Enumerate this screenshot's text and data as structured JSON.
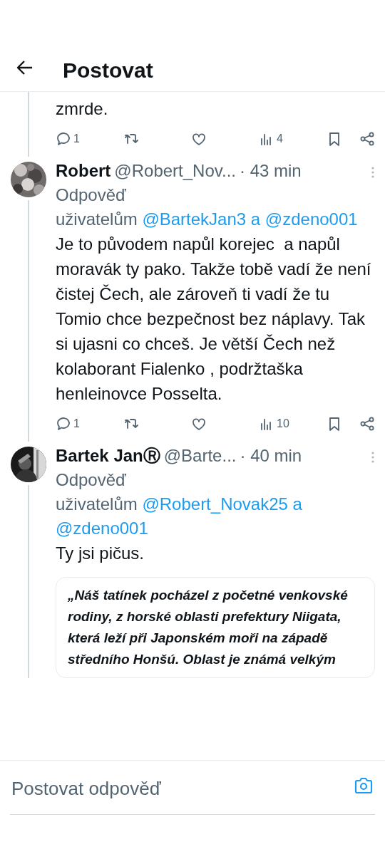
{
  "header": {
    "title": "Postovat"
  },
  "posts": [
    {
      "kind": "fragment",
      "text": "zmrde.",
      "actions": {
        "replies": "1",
        "views": "4"
      }
    },
    {
      "kind": "reply",
      "name": "Robert",
      "handle": "@Robert_Nov...",
      "time": "· 43 min",
      "reply_label": "Odpověď",
      "reply_prefix": "uživatelům",
      "mentions": [
        "@BartekJan3",
        "@zdeno001"
      ],
      "mention_joiner": "a",
      "text": "Je to původem napůl korejec  a napůl moravák ty pako. Takže tobě vadí že není čistej Čech, ale zároveň ti vadí že tu Tomio chce bezpečnost bez náplavy. Tak si ujasni co chceš. Je větší Čech než kolaborant Fialenko , podržtaška henleinovce Posselta.",
      "actions": {
        "replies": "1",
        "views": "10"
      }
    },
    {
      "kind": "reply",
      "name": "Bartek JanⓇ",
      "handle": "@Barte...",
      "time": "· 40 min",
      "reply_label": "Odpověď",
      "reply_prefix": "uživatelům",
      "mentions": [
        "@Robert_Novak25",
        "@zdeno001"
      ],
      "mention_joiner": "a",
      "text": "Ty jsi pičus.",
      "quote": "„Náš tatínek pocházel z početné venkovské rodiny, z horské oblasti prefektury Niigata, která leží při Japonském moři na západě středního Honšú. Oblast je známá velkým"
    }
  ],
  "composer": {
    "placeholder": "Postovat odpověď"
  }
}
